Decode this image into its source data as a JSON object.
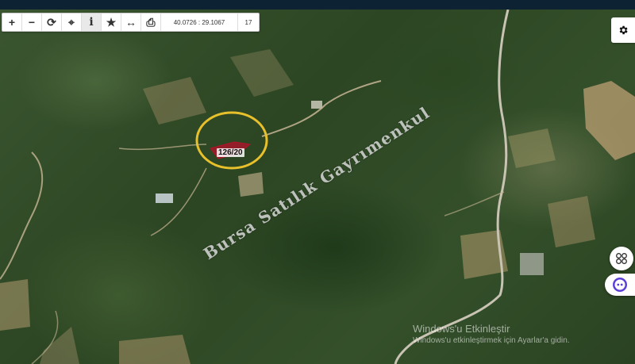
{
  "toolbar": {
    "buttons": [
      {
        "name": "zoom-in-button",
        "icon": "plus-icon",
        "glyph": "+"
      },
      {
        "name": "zoom-out-button",
        "icon": "minus-icon",
        "glyph": "−"
      },
      {
        "name": "refresh-button",
        "icon": "refresh-icon",
        "glyph": "⟳"
      },
      {
        "name": "locate-button",
        "icon": "crosshair-icon",
        "glyph": "⌖"
      },
      {
        "name": "info-button",
        "icon": "info-icon",
        "glyph": "i"
      },
      {
        "name": "favorite-button",
        "icon": "star-icon",
        "glyph": "★"
      },
      {
        "name": "measure-button",
        "icon": "ruler-icon",
        "glyph": "↔"
      },
      {
        "name": "print-button",
        "icon": "printer-icon",
        "glyph": "⎙"
      }
    ],
    "coordinates": "40.0726 : 29.1067",
    "zoom_level": "17"
  },
  "map": {
    "parcel_label": "126/20",
    "highlight_color": "#e7c02c",
    "parcel_color": "#b3122a",
    "watermark_brand": "Bursa Satılık Gayrımenkul"
  },
  "os_watermark": {
    "line1": "Windows'u Etkinleştir",
    "line2": "Windows'u etkinleştirmek için Ayarlar'a gidin."
  },
  "side_buttons": {
    "settings_icon": "gear-icon",
    "layers_icon": "apps-icon",
    "assistant_icon": "chat-bot-icon"
  }
}
